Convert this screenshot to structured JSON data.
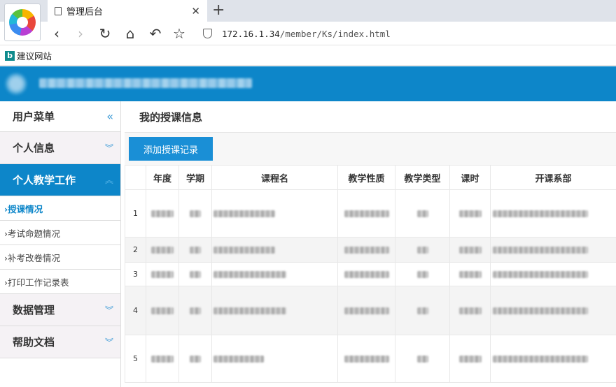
{
  "browser": {
    "tab_title": "管理后台",
    "tab_close": "✕",
    "new_tab": "+",
    "url_host": "172.16.1.34",
    "url_path": "/member/Ks/index.html",
    "bookmark_label": "建议网站",
    "bookmark_icon_letter": "b"
  },
  "sidebar": {
    "menu_title": "用户菜单",
    "collapse_glyph": "«",
    "sections": {
      "personal_info": "个人信息",
      "teaching": "个人教学工作",
      "data_mgmt": "数据管理",
      "help_docs": "帮助文档"
    },
    "items": [
      {
        "label": "›授课情况",
        "current": true
      },
      {
        "label": "›考试命题情况",
        "current": false
      },
      {
        "label": "›补考改卷情况",
        "current": false
      },
      {
        "label": "›打印工作记录表",
        "current": false
      }
    ]
  },
  "main": {
    "title": "我的授课信息",
    "add_button": "添加授课记录",
    "columns": [
      "",
      "年度",
      "学期",
      "课程名",
      "教学性质",
      "教学类型",
      "课时",
      "开课系部"
    ],
    "rows": [
      "1",
      "2",
      "3",
      "4",
      "5"
    ]
  },
  "colors": {
    "brand_blue": "#0d86c9",
    "button_blue": "#1a8fd6"
  }
}
